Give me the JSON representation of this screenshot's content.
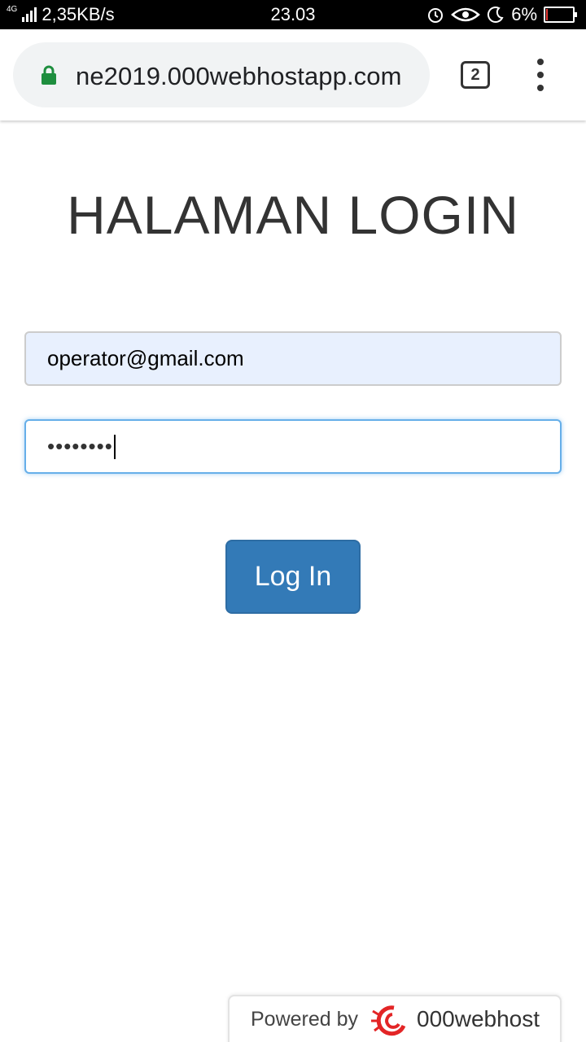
{
  "status_bar": {
    "network_type": "4G",
    "speed": "2,35KB/s",
    "time": "23.03",
    "battery_percent": "6%",
    "battery_level": 0.06,
    "icons": [
      "alarm-icon",
      "eye-comfort-icon",
      "do-not-disturb-icon"
    ]
  },
  "browser": {
    "url": "ne2019.000webhostapp.com",
    "tab_count": "2",
    "secure_color": "#1e8e3e"
  },
  "login": {
    "title": "HALAMAN LOGIN",
    "email_value": "operator@gmail.com",
    "password_value": "••••••••",
    "button_label": "Log In",
    "button_color": "#337ab7"
  },
  "footer": {
    "powered_by": "Powered by",
    "brand": "000webhost",
    "brand_color": "#e32526"
  }
}
